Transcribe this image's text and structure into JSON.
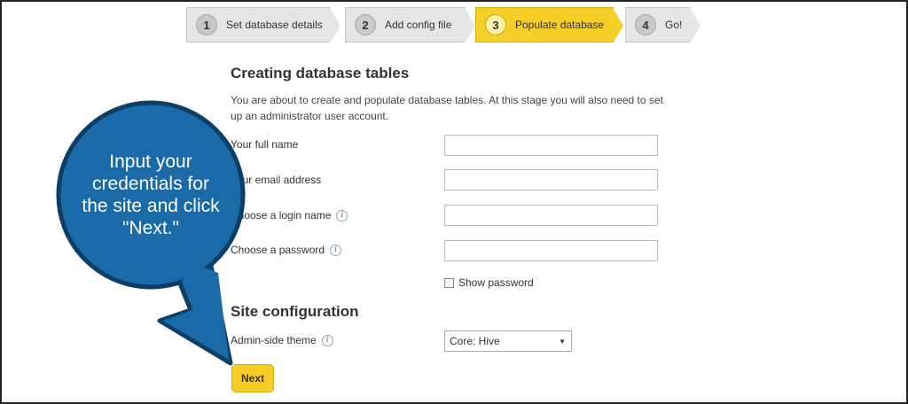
{
  "steps": [
    {
      "num": "1",
      "label": "Set database details"
    },
    {
      "num": "2",
      "label": "Add config file"
    },
    {
      "num": "3",
      "label": "Populate database"
    },
    {
      "num": "4",
      "label": "Go!"
    }
  ],
  "section1": {
    "title": "Creating database tables",
    "intro": "You are about to create and populate database tables. At this stage you will also need to set up an administrator user account."
  },
  "fields": {
    "full_name_label": "Your full name",
    "email_label": "Your email address",
    "login_label": "Choose a login name",
    "password_label": "Choose a password",
    "show_password": "Show password"
  },
  "section2": {
    "title": "Site configuration",
    "theme_label": "Admin-side theme",
    "theme_value": "Core: Hive"
  },
  "next_label": "Next",
  "callout": {
    "text": "Input your credentials for the site and click \"Next.\"",
    "color": "#1a6aa8"
  },
  "colors": {
    "accent": "#f5cf27",
    "callout": "#1a6aa8"
  }
}
